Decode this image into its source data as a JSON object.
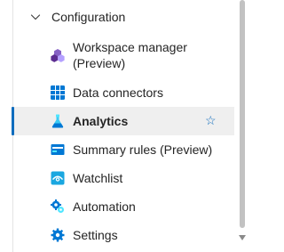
{
  "section": {
    "label": "Configuration",
    "expanded": true
  },
  "items": [
    {
      "label": "Workspace manager (Preview)",
      "icon": "workspace-manager-icon"
    },
    {
      "label": "Data connectors",
      "icon": "data-connectors-icon"
    },
    {
      "label": "Analytics",
      "icon": "analytics-icon",
      "active": true
    },
    {
      "label": "Summary rules (Preview)",
      "icon": "summary-rules-icon"
    },
    {
      "label": "Watchlist",
      "icon": "watchlist-icon"
    },
    {
      "label": "Automation",
      "icon": "automation-icon"
    },
    {
      "label": "Settings",
      "icon": "settings-icon"
    }
  ],
  "favorite_star": "☆",
  "colors": {
    "accent": "#0f6cbd",
    "active_bg": "#efefef",
    "text": "#242424"
  }
}
